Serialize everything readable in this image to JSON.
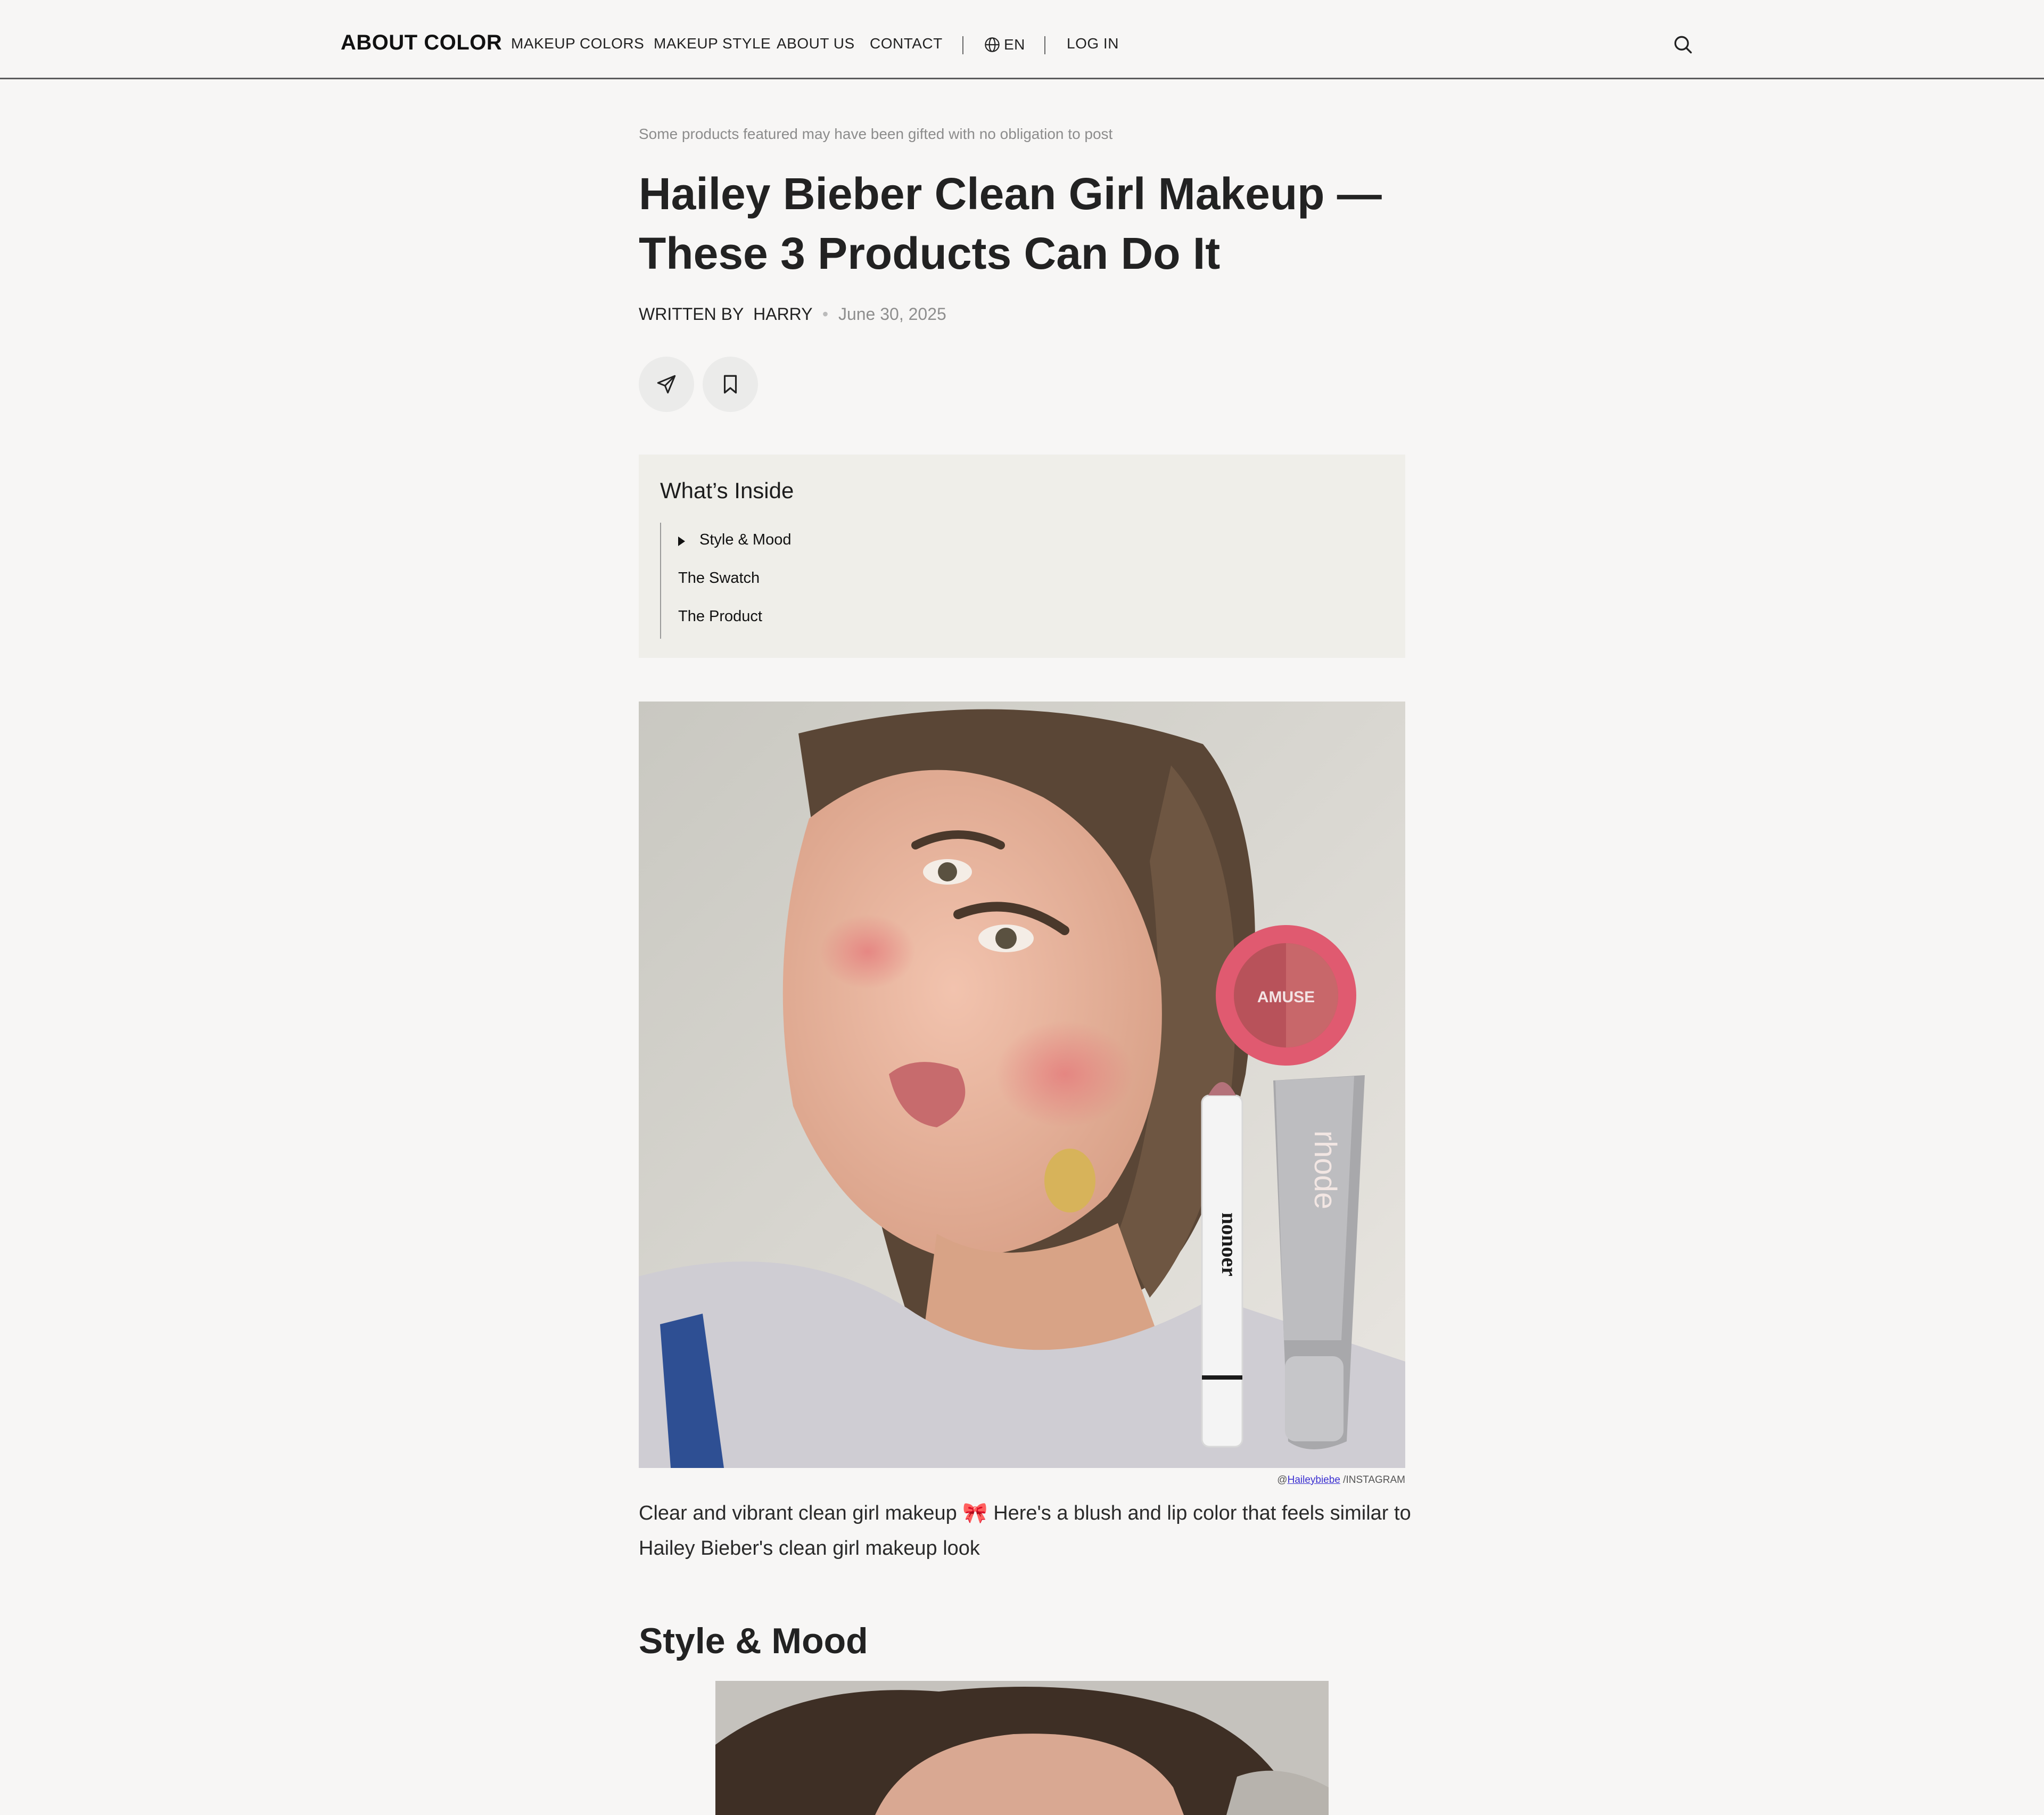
{
  "header": {
    "logo": "ABOUT COLOR",
    "nav": [
      "MAKEUP COLORS",
      "MAKEUP STYLE",
      "ABOUT US",
      "CONTACT"
    ],
    "language": "EN",
    "login": "LOG IN",
    "icons": {
      "language": "globe-icon",
      "search": "search-icon"
    }
  },
  "article": {
    "disclaimer": "Some products featured may have been gifted with no obligation to post",
    "title": "Hailey Bieber Clean Girl Makeup — These 3 Products Can Do It",
    "byline_prefix": "WRITTEN BY",
    "author": "HARRY",
    "date": "June 30, 2025",
    "actions": [
      "share-icon",
      "bookmark-icon"
    ]
  },
  "toc": {
    "title": "What’s Inside",
    "items": [
      "Style & Mood",
      "The Swatch",
      "The Product"
    ]
  },
  "hero": {
    "products": [
      "AMUSE",
      "nonoer",
      "rhode"
    ],
    "credit_prefix": "@",
    "credit_handle": "Haileybiebe",
    "credit_suffix": "/INSTAGRAM"
  },
  "caption": "Clear and vibrant clean girl makeup 🎀 Here's a blush and lip color that feels similar to Hailey Bieber's clean girl makeup look",
  "section_heading": "Style & Mood",
  "colors": {
    "background": "#f7f6f5",
    "toc_bg": "#efeee9",
    "blush": "#e05a70",
    "text": "#222222"
  }
}
